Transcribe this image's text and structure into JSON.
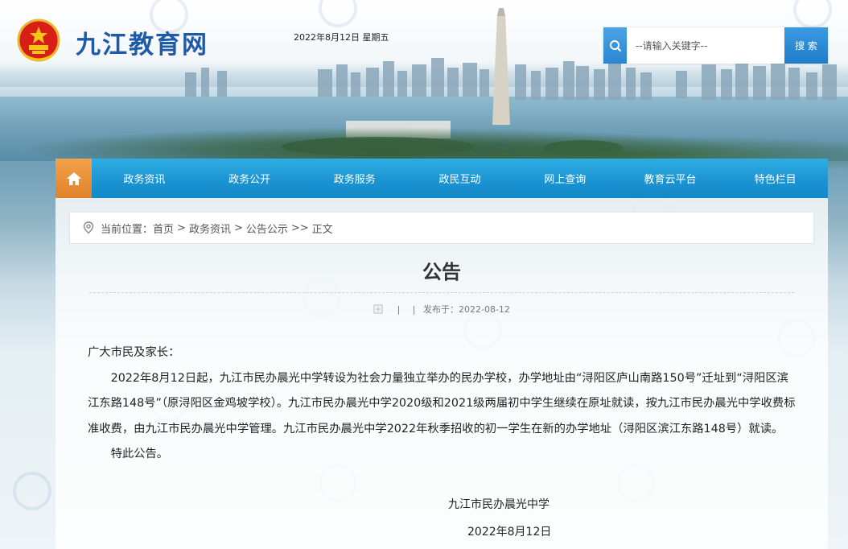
{
  "header": {
    "site_title": "九江教育网",
    "date": "2022年8月12日 星期五",
    "search": {
      "placeholder": "--请输入关键字--",
      "button_label": "搜 索"
    }
  },
  "nav": {
    "items": [
      "政务资讯",
      "政务公开",
      "政务服务",
      "政民互动",
      "网上查询",
      "教育云平台",
      "特色栏目"
    ]
  },
  "breadcrumb": {
    "prefix": "当前位置：",
    "items": [
      "首页",
      "政务资讯",
      "公告公示"
    ],
    "separator": ">",
    "last_separator": ">>",
    "current": "正文"
  },
  "article": {
    "title": "公告",
    "meta_sep": "|",
    "published": "发布于：2022-08-12",
    "salutation": "广大市民及家长：",
    "paragraphs": [
      "2022年8月12日起，九江市民办晨光中学转设为社会力量独立举办的民办学校，办学地址由“浔阳区庐山南路150号”迁址到“浔阳区滨江东路148号”（原浔阳区金鸡坡学校）。九江市民办晨光中学2020级和2021级两届初中学生继续在原址就读，按九江市民办晨光中学收费标准收费，由九江市民办晨光中学管理。九江市民办晨光中学2022年秋季招收的初一学生在新的办学地址（浔阳区滨江东路148号）就读。",
      "特此公告。"
    ],
    "signature": "九江市民办晨光中学",
    "sign_date": "2022年8月12日"
  },
  "icons": {
    "home": "home-icon",
    "search": "search-icon",
    "location": "location-pin-icon",
    "document": "document-icon",
    "emblem": "national-emblem-icon"
  },
  "colors": {
    "nav_blue": "#1c94d2",
    "home_orange": "#e0822a",
    "title_blue": "#1e5aa8"
  }
}
